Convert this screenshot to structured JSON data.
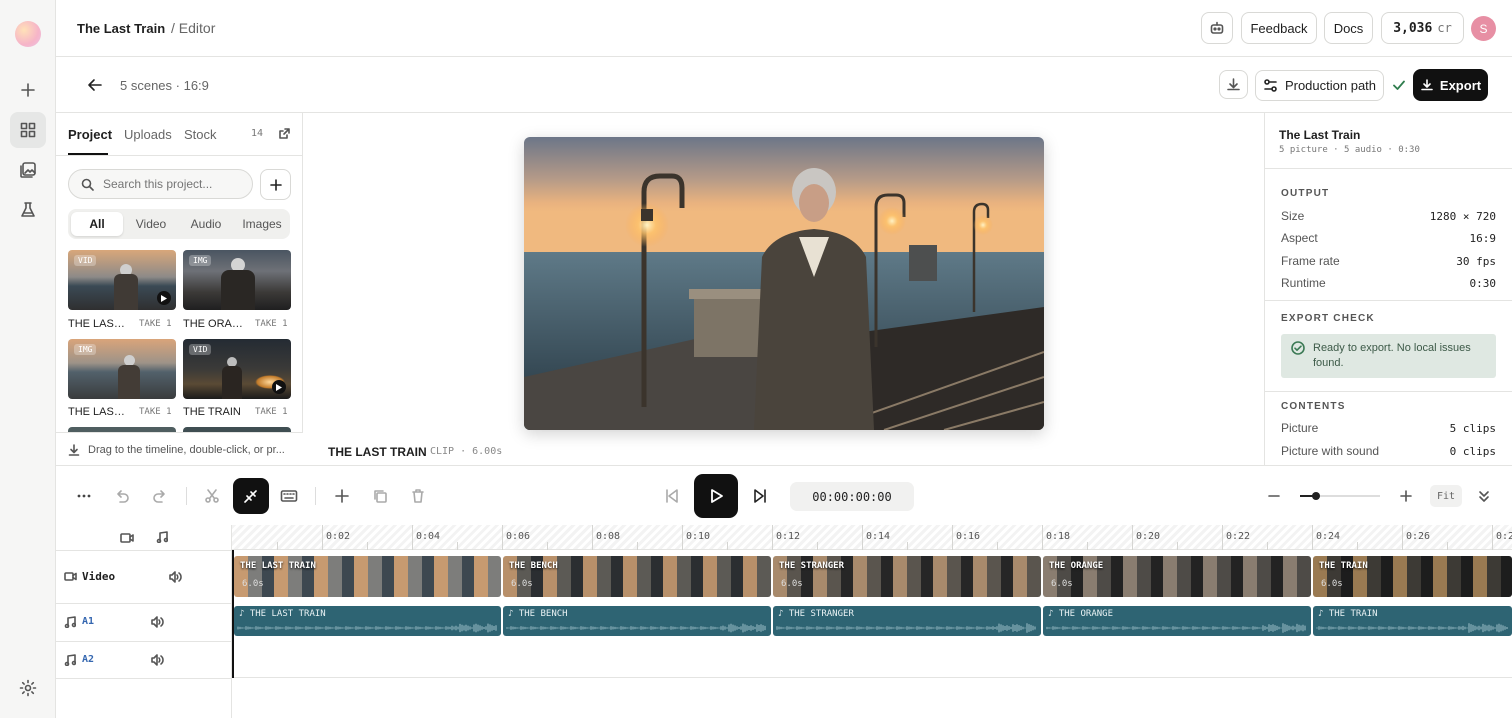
{
  "app": {
    "project_title": "The Last Train",
    "breadcrumb": "/ Editor"
  },
  "topbar": {
    "feedback_label": "Feedback",
    "docs_label": "Docs",
    "credits_value": "3,036",
    "credits_unit": "cr",
    "avatar_initial": "S"
  },
  "subbar": {
    "scene_info": "5 scenes · 16:9",
    "production_label": "Production path",
    "export_label": "Export"
  },
  "library": {
    "tabs": [
      "Project",
      "Uploads",
      "Stock"
    ],
    "count": "14",
    "search_placeholder": "Search this project...",
    "filters": [
      "All",
      "Video",
      "Audio",
      "Images"
    ],
    "items": [
      {
        "badge": "VID",
        "name": "THE LAST TRAIN",
        "take": "TAKE 1",
        "playable": true
      },
      {
        "badge": "IMG",
        "name": "THE ORANGE",
        "take": "TAKE 1",
        "playable": false
      },
      {
        "badge": "IMG",
        "name": "THE LAST TRAIN",
        "take": "TAKE 1",
        "playable": false
      },
      {
        "badge": "VID",
        "name": "THE TRAIN",
        "take": "TAKE 1",
        "playable": true
      }
    ],
    "footer_hint": "Drag to the timeline, double-click, or pr..."
  },
  "preview": {
    "clip_name": "THE LAST TRAIN",
    "clip_meta": "CLIP · 6.00s"
  },
  "inspector": {
    "title": "The Last Train",
    "subtitle": "5 picture · 5 audio · 0:30",
    "output_heading": "OUTPUT",
    "output": [
      {
        "k": "Size",
        "v": "1280 × 720"
      },
      {
        "k": "Aspect",
        "v": "16:9"
      },
      {
        "k": "Frame rate",
        "v": "30 fps"
      },
      {
        "k": "Runtime",
        "v": "0:30"
      }
    ],
    "export_check_heading": "EXPORT CHECK",
    "export_check_message_1": "Ready to export. No local issues",
    "export_check_message_2": "found.",
    "contents_heading": "CONTENTS",
    "contents": [
      {
        "k": "Picture",
        "v": "5 clips"
      },
      {
        "k": "Picture with sound",
        "v": "0 clips"
      }
    ]
  },
  "transport": {
    "timecode": "00:00:00:00",
    "zoom_label": "Fit",
    "zoom_level": 0.2
  },
  "timeline": {
    "ruler_labels": [
      "0:02",
      "0:04",
      "0:06",
      "0:08",
      "0:10",
      "0:12",
      "0:14",
      "0:16",
      "0:18",
      "0:20",
      "0:22",
      "0:24",
      "0:26",
      "0:2"
    ],
    "tracks": [
      {
        "name": "Video"
      },
      {
        "name": "A1"
      },
      {
        "name": "A2"
      }
    ],
    "video_clips": [
      {
        "title": "THE LAST TRAIN",
        "dur": "6.0s"
      },
      {
        "title": "THE BENCH",
        "dur": "6.0s"
      },
      {
        "title": "THE STRANGER",
        "dur": "6.0s"
      },
      {
        "title": "THE ORANGE",
        "dur": "6.0s"
      },
      {
        "title": "THE TRAIN",
        "dur": "6.0s"
      }
    ],
    "audio_clips": [
      {
        "title": "♪ THE LAST TRAIN"
      },
      {
        "title": "♪ THE BENCH"
      },
      {
        "title": "♪ THE STRANGER"
      },
      {
        "title": "♪ THE ORANGE"
      },
      {
        "title": "♪ THE TRAIN"
      }
    ]
  },
  "colors": {
    "accent": "#111111",
    "audio_clip": "#2e6473",
    "ready_bg": "#dfe8e2"
  }
}
